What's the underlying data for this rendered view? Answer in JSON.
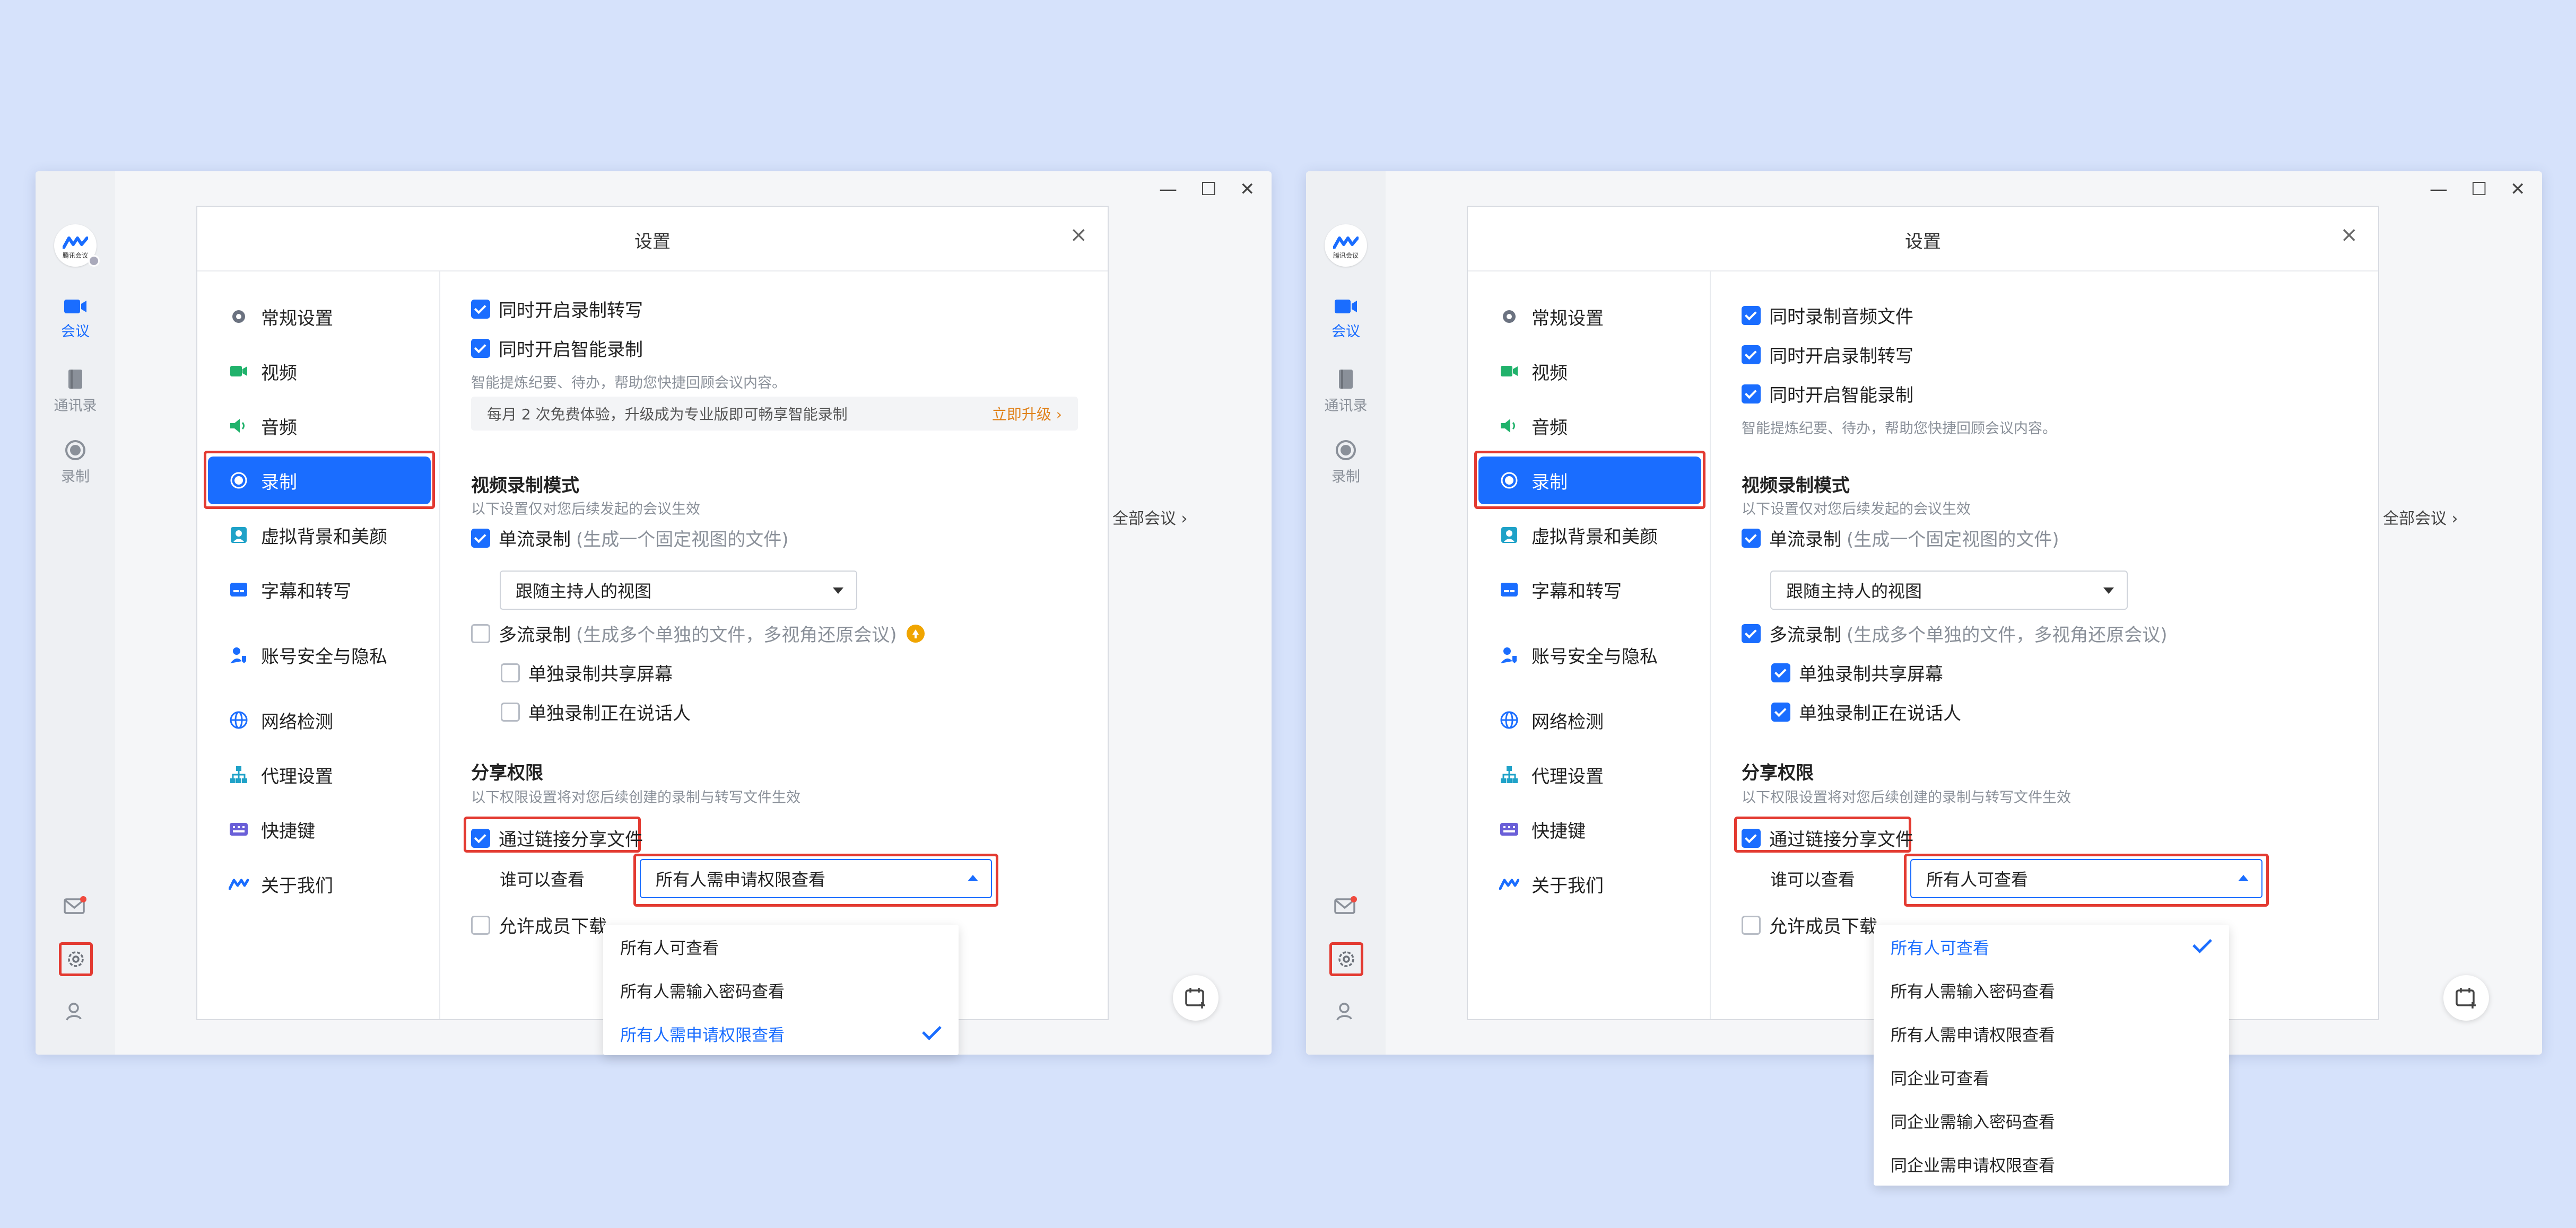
{
  "colors": {
    "accent": "#1a6dff",
    "highlight": "#e33a31",
    "background": "#d6e2fb"
  },
  "rail": {
    "logo_text": "腾讯会议",
    "items": [
      {
        "label": "会议",
        "icon": "video-icon"
      },
      {
        "label": "通讯录",
        "icon": "contacts-icon"
      },
      {
        "label": "录制",
        "icon": "record-icon"
      }
    ]
  },
  "window": {
    "minimize": "—",
    "maximize": "☐",
    "close": "✕",
    "all_meetings": "全部会议"
  },
  "dialog": {
    "title": "设置",
    "close": "×",
    "nav": [
      {
        "label": "常规设置",
        "icon": "gear-icon"
      },
      {
        "label": "视频",
        "icon": "camera-icon"
      },
      {
        "label": "音频",
        "icon": "speaker-icon"
      },
      {
        "label": "录制",
        "icon": "record-icon"
      },
      {
        "label": "虚拟背景和美颜",
        "icon": "portrait-icon"
      },
      {
        "label": "字幕和转写",
        "icon": "subtitles-icon"
      },
      {
        "label": "账号安全与隐私",
        "icon": "shield-user-icon"
      },
      {
        "label": "网络检测",
        "icon": "globe-icon"
      },
      {
        "label": "代理设置",
        "icon": "network-icon"
      },
      {
        "label": "快捷键",
        "icon": "keyboard-icon"
      },
      {
        "label": "关于我们",
        "icon": "logo-icon"
      }
    ]
  },
  "left": {
    "rec_transcribe": "同时开启录制转写",
    "smart_record": "同时开启智能录制",
    "smart_hint": "智能提炼纪要、待办，帮助您快捷回顾会议内容。",
    "upgrade_text": "每月 2 次免费体验，升级成为专业版即可畅享智能录制",
    "upgrade_link": "立即升级",
    "video_mode_title": "视频录制模式",
    "video_mode_hint": "以下设置仅对您后续发起的会议生效",
    "single_stream": "单流录制",
    "single_stream_hint": "(生成一个固定视图的文件)",
    "view_select": "跟随主持人的视图",
    "multi_stream": "多流录制",
    "multi_stream_hint": "(生成多个单独的文件，多视角还原会议)",
    "solo_screen": "单独录制共享屏幕",
    "solo_speaker": "单独录制正在说话人",
    "share_title": "分享权限",
    "share_hint": "以下权限设置将对您后续创建的录制与转写文件生效",
    "share_link": "通过链接分享文件",
    "who_can_view": "谁可以查看",
    "perm_selected": "所有人需申请权限查看",
    "allow_download": "允许成员下载",
    "menu": [
      "所有人可查看",
      "所有人需输入密码查看",
      "所有人需申请权限查看"
    ]
  },
  "right": {
    "rec_audio": "同时录制音频文件",
    "rec_transcribe": "同时开启录制转写",
    "smart_record": "同时开启智能录制",
    "smart_hint": "智能提炼纪要、待办，帮助您快捷回顾会议内容。",
    "video_mode_title": "视频录制模式",
    "video_mode_hint": "以下设置仅对您后续发起的会议生效",
    "single_stream": "单流录制",
    "single_stream_hint": "(生成一个固定视图的文件)",
    "view_select": "跟随主持人的视图",
    "multi_stream": "多流录制",
    "multi_stream_hint": "(生成多个单独的文件，多视角还原会议)",
    "solo_screen": "单独录制共享屏幕",
    "solo_speaker": "单独录制正在说话人",
    "share_title": "分享权限",
    "share_hint": "以下权限设置将对您后续创建的录制与转写文件生效",
    "share_link": "通过链接分享文件",
    "who_can_view": "谁可以查看",
    "perm_selected": "所有人可查看",
    "allow_download": "允许成员下载",
    "menu": [
      "所有人可查看",
      "所有人需输入密码查看",
      "所有人需申请权限查看",
      "同企业可查看",
      "同企业需输入密码查看",
      "同企业需申请权限查看"
    ]
  }
}
